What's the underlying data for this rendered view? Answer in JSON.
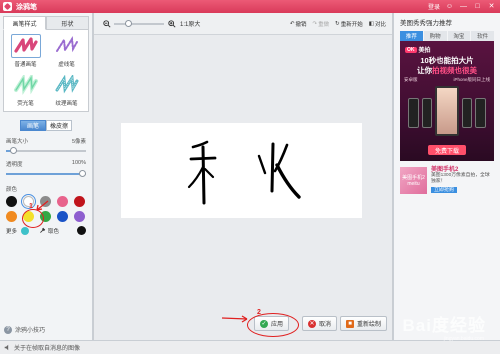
{
  "window": {
    "title": "涂鸦笔",
    "controls": [
      "登录",
      "☺",
      "—",
      "□",
      "✕"
    ]
  },
  "left_panel": {
    "tabs": [
      {
        "label": "画笔样式",
        "active": true
      },
      {
        "label": "形状",
        "active": false
      }
    ],
    "brushes": [
      {
        "label": "普通画笔",
        "icon": "brush-plain-icon",
        "color": "#d9467a",
        "selected": true
      },
      {
        "label": "虚线笔",
        "icon": "brush-dashed-icon",
        "color": "#9a6cd0",
        "selected": false
      },
      {
        "label": "荧光笔",
        "icon": "brush-fluorescent-icon",
        "color": "#6fd7a6",
        "selected": false
      },
      {
        "label": "纹理画笔",
        "icon": "brush-texture-icon",
        "color": "#5ab8c4",
        "selected": false
      }
    ],
    "mode": [
      {
        "label": "画笔",
        "active": true
      },
      {
        "label": "橡皮擦",
        "active": false
      }
    ],
    "brush_size": {
      "label": "画笔大小",
      "value": "5像素",
      "fraction": 0.05
    },
    "opacity": {
      "label": "透明度",
      "value": "100%",
      "fraction": 1.0
    },
    "colors_label": "颜色",
    "colors": [
      {
        "hex": "#111111"
      },
      {
        "hex": "#ffffff",
        "selected": true
      },
      {
        "hex": "#8c8c8c"
      },
      {
        "hex": "#e8638c"
      },
      {
        "hex": "#c0141c"
      },
      {
        "hex": "#f08a20"
      },
      {
        "hex": "#f3e02a"
      },
      {
        "hex": "#33a846"
      },
      {
        "hex": "#1a53c7"
      },
      {
        "hex": "#8e5fcf"
      }
    ],
    "more_label": "更多",
    "picker_label": "取色",
    "picker_color": "#111111",
    "tip": "涂鸦小技巧"
  },
  "toolbar": {
    "zoom_label": "1:1原大",
    "zoom_fraction": 0.25,
    "actions": [
      {
        "label": "撤销",
        "icon": "undo-icon",
        "glyph": "↶"
      },
      {
        "label": "重做",
        "icon": "redo-icon",
        "glyph": "↷"
      },
      {
        "label": "重新开始",
        "icon": "restart-icon",
        "glyph": "↻"
      },
      {
        "label": "对比",
        "icon": "compare-icon",
        "glyph": "◧"
      }
    ]
  },
  "actions": {
    "apply": "应用",
    "cancel": "取消",
    "redraw": "重新绘制"
  },
  "right_panel": {
    "title": "美图秀秀强力推荐",
    "tabs": [
      {
        "label": "推荐",
        "active": true
      },
      {
        "label": "购物",
        "active": false
      },
      {
        "label": "淘宝",
        "active": false
      },
      {
        "label": "软件",
        "active": false
      }
    ],
    "ad": {
      "brand": "美拍",
      "line1": "10秒也能拍大片",
      "line2_pre": "让你",
      "line2_hl": "拍视频也很美",
      "sub_left": "安卓版",
      "sub_right": "iPhone版同日上线",
      "cta": "免费下载"
    },
    "promo": {
      "thumb": "美图手机2 meitu",
      "title": "美图手机2",
      "desc": "美图1300万像素自拍，全球独家！",
      "button": "立即抢购"
    }
  },
  "statusbar": {
    "text": "关于在帧取自消息的图像"
  },
  "annotations": {
    "step1": "1",
    "step2": "2",
    "accent": "#e02020"
  },
  "watermark": {
    "text": "Bai度经验",
    "sub": "jingyan.baidu.com"
  }
}
